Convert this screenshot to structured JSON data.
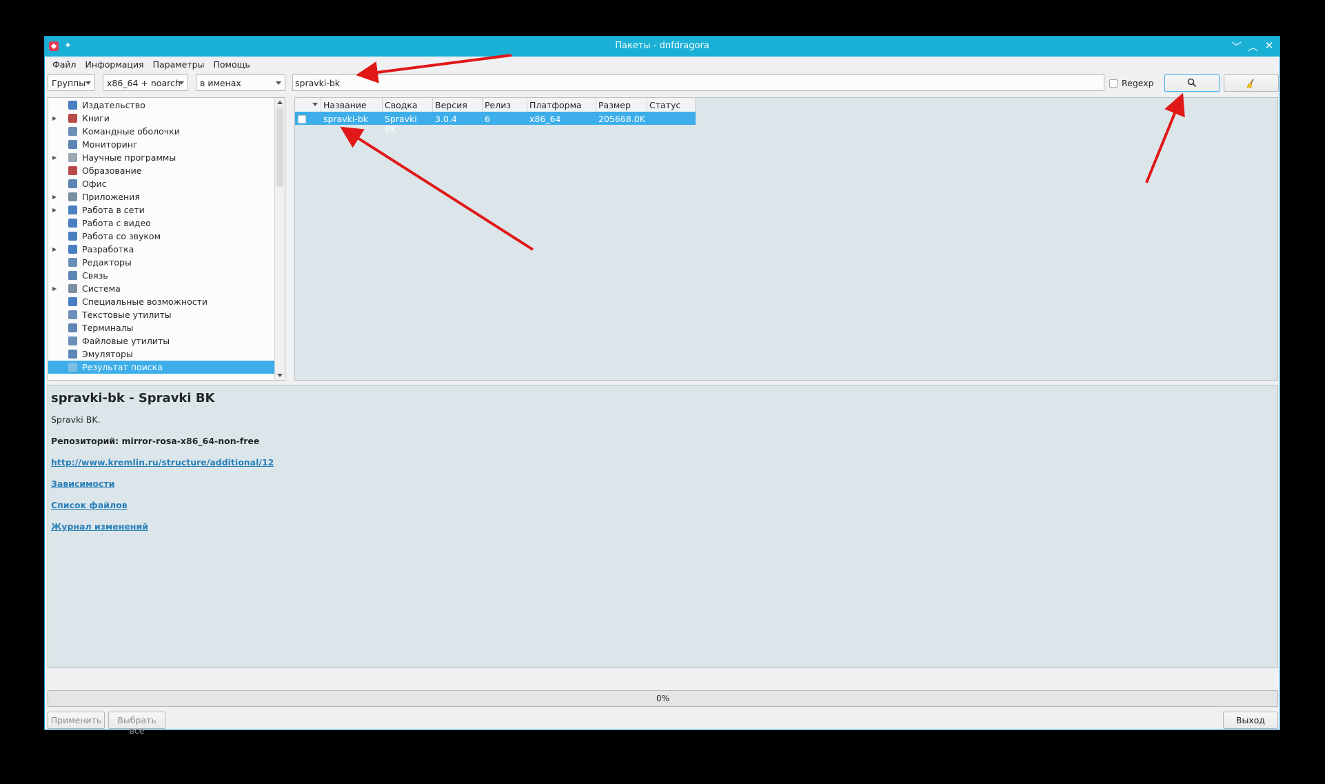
{
  "window": {
    "title": "Пакеты - dnfdragora",
    "controls": {
      "minimize": "﹀",
      "maximize": "︿",
      "close": "✕"
    }
  },
  "menu": [
    "Файл",
    "Информация",
    "Параметры",
    "Помощь"
  ],
  "toolbar": {
    "view_combo": "Группы",
    "arch_combo": "x86_64 + noarch",
    "field_combo": "в именах",
    "search_value": "spravki-bk",
    "regexp_label": "Regexp",
    "regexp_checked": false,
    "search_icon": "search-icon",
    "clear_icon": "broom-icon"
  },
  "tree": {
    "items": [
      {
        "label": "Издательство",
        "expandable": false,
        "icon": "book-icon",
        "color": "#4a7fc1"
      },
      {
        "label": "Книги",
        "expandable": true,
        "icon": "books-icon",
        "color": "#b84a4a"
      },
      {
        "label": "Командные оболочки",
        "expandable": false,
        "icon": "terminal-icon",
        "color": "#6b8fb8"
      },
      {
        "label": "Мониторинг",
        "expandable": false,
        "icon": "gauge-icon",
        "color": "#5d86b5"
      },
      {
        "label": "Научные программы",
        "expandable": true,
        "icon": "atom-icon",
        "color": "#9aa8b6"
      },
      {
        "label": "Образование",
        "expandable": false,
        "icon": "education-icon",
        "color": "#b84a4a"
      },
      {
        "label": "Офис",
        "expandable": false,
        "icon": "office-icon",
        "color": "#5d86b5"
      },
      {
        "label": "Приложения",
        "expandable": true,
        "icon": "sliders-icon",
        "color": "#7b8fa3"
      },
      {
        "label": "Работа в сети",
        "expandable": true,
        "icon": "globe-icon",
        "color": "#4a7fc1"
      },
      {
        "label": "Работа с видео",
        "expandable": false,
        "icon": "play-icon",
        "color": "#4a7fc1"
      },
      {
        "label": "Работа со звуком",
        "expandable": false,
        "icon": "headphones-icon",
        "color": "#4a7fc1"
      },
      {
        "label": "Разработка",
        "expandable": true,
        "icon": "code-icon",
        "color": "#4a7fc1"
      },
      {
        "label": "Редакторы",
        "expandable": false,
        "icon": "editor-icon",
        "color": "#6b8fb8"
      },
      {
        "label": "Связь",
        "expandable": false,
        "icon": "person-icon",
        "color": "#5d86b5"
      },
      {
        "label": "Система",
        "expandable": true,
        "icon": "sliders-icon",
        "color": "#7b8fa3"
      },
      {
        "label": "Специальные возможности",
        "expandable": false,
        "icon": "accessibility-icon",
        "color": "#4a7fc1"
      },
      {
        "label": "Текстовые утилиты",
        "expandable": false,
        "icon": "text-icon",
        "color": "#6b8fb8"
      },
      {
        "label": "Терминалы",
        "expandable": false,
        "icon": "monitor-icon",
        "color": "#5d86b5"
      },
      {
        "label": "Файловые утилиты",
        "expandable": false,
        "icon": "files-icon",
        "color": "#6b8fb8"
      },
      {
        "label": "Эмуляторы",
        "expandable": false,
        "icon": "monitor-icon",
        "color": "#5d86b5"
      },
      {
        "label": "Результат поиска",
        "expandable": false,
        "icon": "search-result-icon",
        "color": "#7bbfe3",
        "selected": true
      }
    ]
  },
  "table": {
    "columns": [
      "",
      "Название",
      "Сводка",
      "Версия",
      "Релиз",
      "Платформа",
      "Размер",
      "Статус"
    ],
    "rows": [
      {
        "name": "spravki-bk",
        "summary": "Spravki BK",
        "version": "3.0.4",
        "release": "6",
        "platform": "x86_64",
        "size": "205668.0K",
        "status": ""
      }
    ]
  },
  "details": {
    "title": "spravki-bk - Spravki BK",
    "description": "Spravki BK.",
    "repo": "Репозиторий: mirror-rosa-x86_64-non-free",
    "url": "http://www.kremlin.ru/structure/additional/12",
    "deps_link": "Зависимости",
    "files_link": "Список файлов",
    "changelog_link": "Журнал изменений"
  },
  "progress": {
    "text": "0%",
    "value": 0
  },
  "buttons": {
    "apply": "Применить",
    "select_all": "Выбрать все",
    "exit": "Выход"
  },
  "colors": {
    "titlebar": "#1ab0d6",
    "selection": "#3daee9",
    "link": "#2980b9",
    "annotation_arrow": "#e01818"
  }
}
